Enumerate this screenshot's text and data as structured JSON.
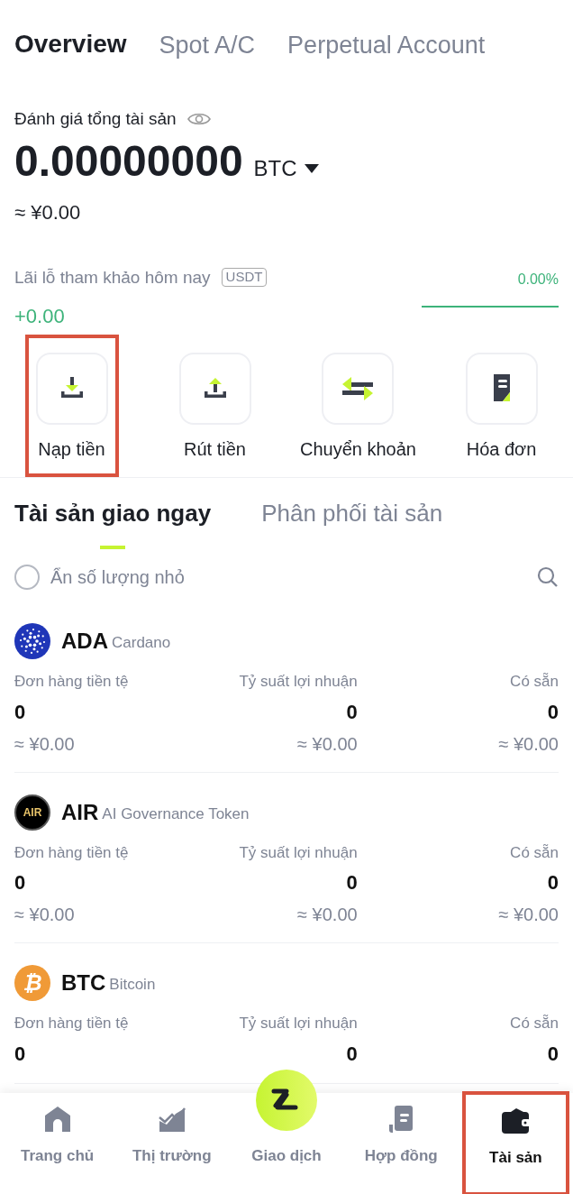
{
  "top_tabs": [
    {
      "label": "Overview",
      "selected": true
    },
    {
      "label": "Spot A/C",
      "selected": false
    },
    {
      "label": "Perpetual Account",
      "selected": false
    }
  ],
  "balance": {
    "label": "Đánh giá tổng tài sản",
    "amount": "0.00000000",
    "unit": "BTC",
    "fiat": "≈ ¥0.00"
  },
  "pnl": {
    "label": "Lãi lỗ tham khảo hôm nay",
    "currency": "USDT",
    "value": "+0.00",
    "percent": "0.00%"
  },
  "actions": [
    {
      "kind": "deposit",
      "label": "Nạp tiền",
      "highlighted": true
    },
    {
      "kind": "withdraw",
      "label": "Rút tiền",
      "highlighted": false
    },
    {
      "kind": "transfer",
      "label": "Chuyển khoản",
      "highlighted": false
    },
    {
      "kind": "bill",
      "label": "Hóa đơn",
      "highlighted": false
    }
  ],
  "section_tabs": [
    {
      "label": "Tài sản giao ngay",
      "selected": true
    },
    {
      "label": "Phân phối tài sản",
      "selected": false
    }
  ],
  "hide_small": {
    "label": "Ẩn số lượng nhỏ",
    "checked": false
  },
  "coins": [
    {
      "kind": "ada",
      "symbol": "ADA",
      "name": "Cardano",
      "columns": [
        {
          "label": "Đơn hàng tiền tệ",
          "value": "0",
          "fiat": "≈ ¥0.00"
        },
        {
          "label": "Tỷ suất lợi nhuận",
          "value": "0",
          "fiat": "≈ ¥0.00"
        },
        {
          "label": "Có sẵn",
          "value": "0",
          "fiat": "≈ ¥0.00"
        }
      ]
    },
    {
      "kind": "air",
      "logo_text": "AIR",
      "symbol": "AIR",
      "name": "AI Governance Token",
      "columns": [
        {
          "label": "Đơn hàng tiền tệ",
          "value": "0",
          "fiat": "≈ ¥0.00"
        },
        {
          "label": "Tỷ suất lợi nhuận",
          "value": "0",
          "fiat": "≈ ¥0.00"
        },
        {
          "label": "Có sẵn",
          "value": "0",
          "fiat": "≈ ¥0.00"
        }
      ]
    },
    {
      "kind": "btc",
      "logo_text": "₿",
      "symbol": "BTC",
      "name": "Bitcoin",
      "columns": [
        {
          "label": "Đơn hàng tiền tệ",
          "value": "0"
        },
        {
          "label": "Tỷ suất lợi nhuận",
          "value": "0"
        },
        {
          "label": "Có sẵn",
          "value": "0"
        }
      ]
    }
  ],
  "nav": [
    {
      "kind": "home",
      "label": "Trang chủ",
      "selected": false,
      "highlighted": false
    },
    {
      "kind": "market",
      "label": "Thị trường",
      "selected": false,
      "highlighted": false
    },
    {
      "kind": "trade",
      "label": "Giao dịch",
      "selected": false,
      "highlighted": false
    },
    {
      "kind": "contract",
      "label": "Hợp đồng",
      "selected": false,
      "highlighted": false
    },
    {
      "kind": "wallet",
      "label": "Tài sản",
      "selected": true,
      "highlighted": true
    }
  ]
}
